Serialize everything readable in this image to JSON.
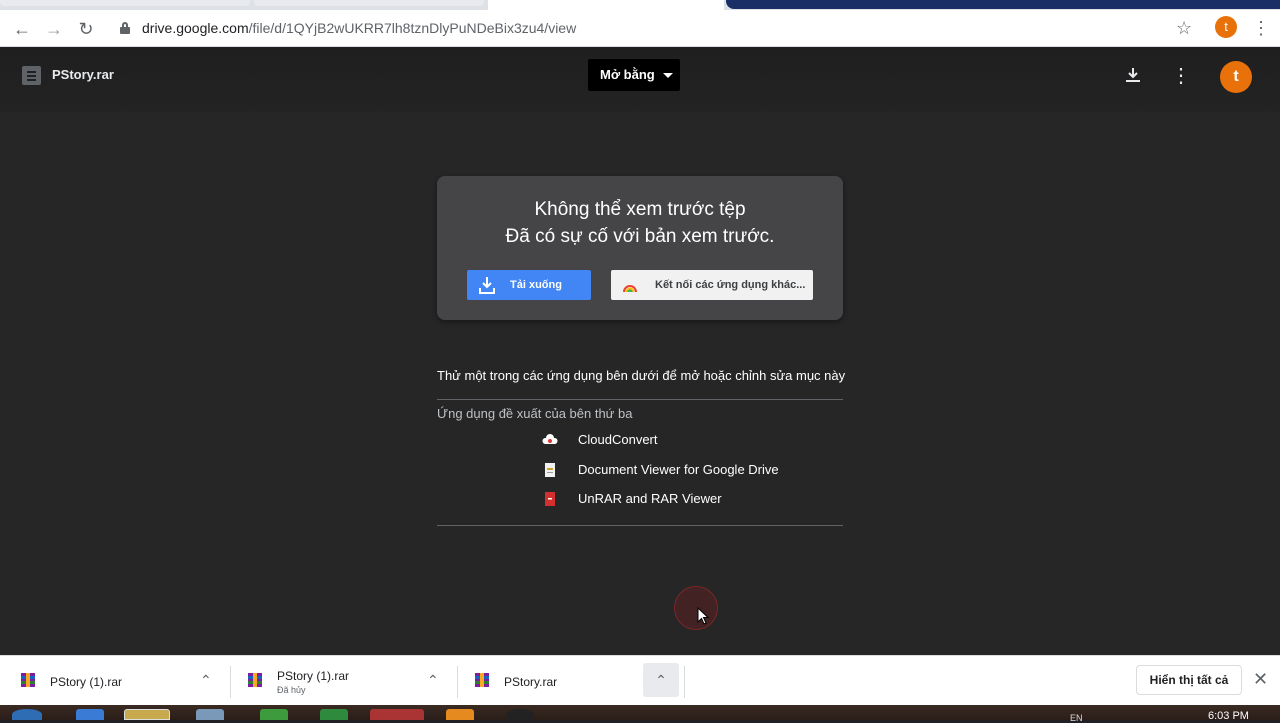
{
  "browser": {
    "url_host": "drive.google.com",
    "url_path": "/file/d/1QYjB2wUKRR7lh8tznDlyPuNDeBix3zu4/view",
    "profile_initial": "t",
    "icons": {
      "back": "arrow-left-icon",
      "forward": "arrow-right-icon",
      "reload": "reload-icon",
      "bookmark": "star-icon",
      "menu": "kebab-icon"
    }
  },
  "viewer": {
    "file_name": "PStory.rar",
    "open_with_label": "Mở bằng",
    "profile_initial": "t",
    "accent_color": "#e8710a"
  },
  "error_card": {
    "title": "Không thể xem trước tệp",
    "subtitle": "Đã có sự cố với bản xem trước.",
    "download_label": "Tải xuống",
    "connect_label": "Kết nối các ứng dụng khác..."
  },
  "apps": {
    "try_text": "Thử một trong các ứng dụng bên dưới để mở hoặc chỉnh sửa mục này",
    "suggested_label": "Ứng dụng đề xuất của bên thứ ba",
    "items": [
      {
        "name": "CloudConvert",
        "icon": "cloudconvert-icon"
      },
      {
        "name": "Document Viewer for Google Drive",
        "icon": "document-viewer-icon"
      },
      {
        "name": "UnRAR and RAR Viewer",
        "icon": "unrar-icon"
      }
    ]
  },
  "downloads": {
    "items": [
      {
        "name": "PStory (1).rar",
        "status": ""
      },
      {
        "name": "PStory (1).rar",
        "status": "Đã hủy"
      },
      {
        "name": "PStory.rar",
        "status": ""
      }
    ],
    "show_all_label": "Hiển thị tất cả"
  },
  "taskbar": {
    "language": "EN",
    "clock": "6:03 PM"
  }
}
